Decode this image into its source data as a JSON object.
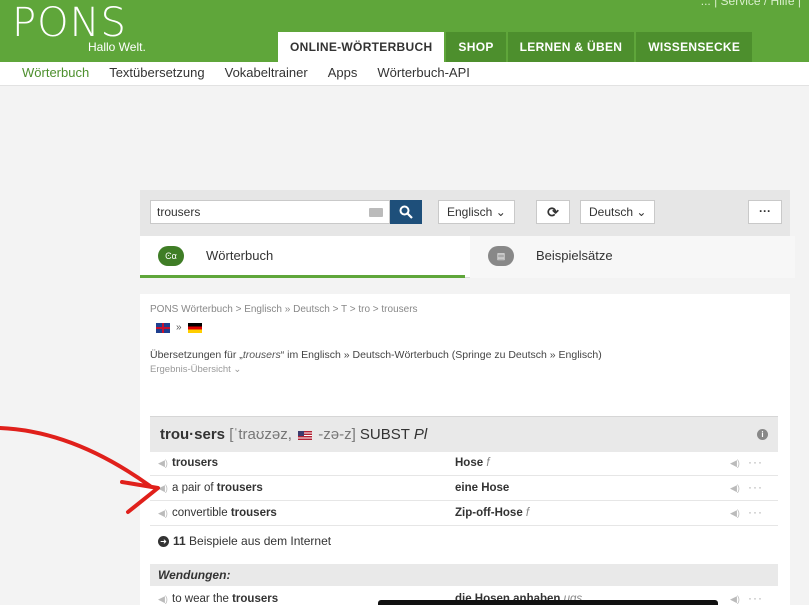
{
  "header": {
    "logo": "PONS",
    "tagline": "Hallo Welt.",
    "top_links": "...  |  Service / Hilfe  |",
    "nav": [
      "ONLINE-WÖRTERBUCH",
      "SHOP",
      "LERNEN & ÜBEN",
      "WISSENSECKE"
    ],
    "active_nav": "ONLINE-WÖRTERBUCH",
    "brand_color": "#5fa63a"
  },
  "subnav": [
    "Wörterbuch",
    "Textübersetzung",
    "Vokabeltrainer",
    "Apps",
    "Wörterbuch-API"
  ],
  "search": {
    "value": "trousers",
    "source_lang": "Englisch ⌄",
    "target_lang": "Deutsch ⌄",
    "swap_icon": "refresh-icon",
    "more_label": "···"
  },
  "modes": {
    "dictionary": "Wörterbuch",
    "examples": "Beispielsätze",
    "dictionary_icon_text": "Ͼα",
    "examples_icon_text": "▤"
  },
  "result": {
    "breadcrumb": "PONS Wörterbuch > Englisch » Deutsch > T > tro > trousers",
    "flag_sep": "»",
    "intro_prefix": "Übersetzungen für „",
    "intro_word": "trousers",
    "intro_suffix": "“ im Englisch » Deutsch-Wörterbuch (Springe zu Deutsch » Englisch)",
    "overview": "Ergebnis-Übersicht ⌄",
    "headword": "trou·sers",
    "phonetic_uk": "[ˈtraʊzəz,",
    "phonetic_us": "-zə-z]",
    "pos": "SUBST",
    "number": "Pl",
    "rows": [
      {
        "src_plain": "",
        "src_bold": "trousers",
        "tgt": "Hose",
        "tgt_note": "f"
      },
      {
        "src_plain": "a pair of ",
        "src_bold": "trousers",
        "tgt": "eine Hose",
        "tgt_note": ""
      },
      {
        "src_plain": "convertible ",
        "src_bold": "trousers",
        "tgt": "Zip-off-Hose",
        "tgt_note": "f"
      }
    ],
    "examples_count": "11",
    "examples_label": " Beispiele aus dem Internet",
    "idioms_label": "Wendungen:",
    "idiom_row": {
      "src_plain": "to wear the ",
      "src_bold": "trousers",
      "tgt": "die Hosen anhaben",
      "tgt_note": "ugs"
    }
  }
}
